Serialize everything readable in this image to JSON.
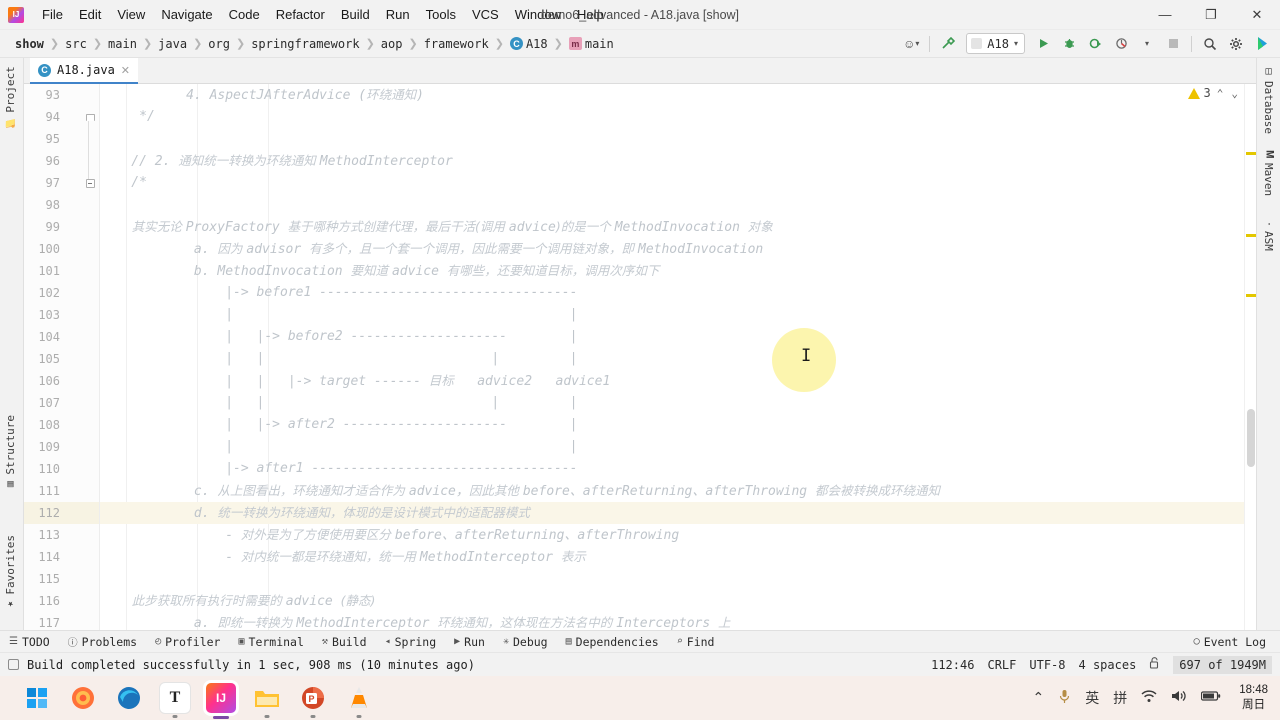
{
  "titlebar": {
    "logo_icon": "intellij-logo-icon",
    "window_title": "demo6_advanced - A18.java [show]",
    "menus": [
      "File",
      "Edit",
      "View",
      "Navigate",
      "Code",
      "Refactor",
      "Build",
      "Run",
      "Tools",
      "VCS",
      "Window",
      "Help"
    ],
    "minimize_icon": "—",
    "maximize_icon": "❐",
    "close_icon": "✕"
  },
  "navbar": {
    "breadcrumbs": [
      "show",
      "src",
      "main",
      "java",
      "org",
      "springframework",
      "aop",
      "framework"
    ],
    "class_crumb": "A18",
    "class_crumb_icon": "C",
    "method_crumb": "main",
    "method_crumb_icon": "m",
    "separator": "❯",
    "toolbar": {
      "profile_icon": "☺",
      "caret_icon": "▾",
      "build_icon": "⚒",
      "run_config": "A18",
      "run_icon": "▶",
      "debug_icon": "⚙",
      "coverage_icon": "◑",
      "profiler_icon": "◴",
      "stop_icon": "■",
      "search_icon": "⌕",
      "settings_icon": "⚙",
      "updates_icon": "◗"
    }
  },
  "left_stripe": {
    "items": [
      {
        "label": "Project",
        "icon": "folder-icon"
      },
      {
        "label": "Structure",
        "icon": "structure-icon"
      },
      {
        "label": "Favorites",
        "icon": "star-icon"
      }
    ]
  },
  "right_stripe": {
    "items": [
      {
        "label": "Database",
        "icon": "database-icon"
      },
      {
        "label": "Maven",
        "icon": "maven-icon"
      },
      {
        "label": "ASM",
        "icon": "asm-icon"
      }
    ]
  },
  "editor_tabs": [
    {
      "label": "A18.java",
      "icon": "java-class-icon",
      "close_icon": "✕",
      "active": true
    }
  ],
  "inspection_widget": {
    "warning_icon": "warning-triangle-icon",
    "warning_count": "3",
    "up_icon": "⌃",
    "down_icon": "⌄"
  },
  "editor": {
    "first_line": 93,
    "highlighted_line": 112,
    "cursor_glyph": "I",
    "lines": [
      {
        "n": 93,
        "indent": 0,
        "segments": [
          {
            "t": "code",
            "v": "           4. AspectJAfterAdvice ("
          },
          {
            "t": "cjk",
            "v": "环绕通知"
          },
          {
            "t": "code",
            "v": ")"
          }
        ]
      },
      {
        "n": 94,
        "indent": 0,
        "fold": "up",
        "segments": [
          {
            "t": "code",
            "v": "     */"
          }
        ]
      },
      {
        "n": 95,
        "indent": 0,
        "segments": []
      },
      {
        "n": 96,
        "indent": 0,
        "segments": [
          {
            "t": "code",
            "v": "    // 2. "
          },
          {
            "t": "cjk",
            "v": "通知统一转换为环绕通知 "
          },
          {
            "t": "code",
            "v": "MethodInterceptor"
          }
        ]
      },
      {
        "n": 97,
        "indent": 0,
        "fold": "down",
        "segments": [
          {
            "t": "code",
            "v": "    /*"
          }
        ]
      },
      {
        "n": 98,
        "indent": 0,
        "segments": []
      },
      {
        "n": 99,
        "indent": 0,
        "segments": [
          {
            "t": "cjk",
            "v": "        其实无论 "
          },
          {
            "t": "code",
            "v": "ProxyFactory "
          },
          {
            "t": "cjk",
            "v": "基于哪种方式创建代理，最后干活(调用 "
          },
          {
            "t": "code",
            "v": "advice"
          },
          {
            "t": "cjk",
            "v": ")的是一个 "
          },
          {
            "t": "code",
            "v": "MethodInvocation "
          },
          {
            "t": "cjk",
            "v": "对象"
          }
        ]
      },
      {
        "n": 100,
        "indent": 0,
        "segments": [
          {
            "t": "code",
            "v": "            a. "
          },
          {
            "t": "cjk",
            "v": "因为 "
          },
          {
            "t": "code",
            "v": "advisor "
          },
          {
            "t": "cjk",
            "v": "有多个，且一个套一个调用，因此需要一个调用链对象，即 "
          },
          {
            "t": "code",
            "v": "MethodInvocation"
          }
        ]
      },
      {
        "n": 101,
        "indent": 0,
        "segments": [
          {
            "t": "code",
            "v": "            b. MethodInvocation "
          },
          {
            "t": "cjk",
            "v": "要知道 "
          },
          {
            "t": "code",
            "v": "advice "
          },
          {
            "t": "cjk",
            "v": "有哪些，还要知道目标，调用次序如下"
          }
        ]
      },
      {
        "n": 102,
        "indent": 0,
        "segments": [
          {
            "t": "code",
            "v": "                |-> before1 ---------------------------------"
          }
        ]
      },
      {
        "n": 103,
        "indent": 0,
        "segments": [
          {
            "t": "code",
            "v": "                |                                           |"
          }
        ]
      },
      {
        "n": 104,
        "indent": 0,
        "segments": [
          {
            "t": "code",
            "v": "                |   |-> before2 --------------------        |"
          }
        ]
      },
      {
        "n": 105,
        "indent": 0,
        "segments": [
          {
            "t": "code",
            "v": "                |   |                             |         |"
          }
        ]
      },
      {
        "n": 106,
        "indent": 0,
        "segments": [
          {
            "t": "code",
            "v": "                |   |   |-> target ------ "
          },
          {
            "t": "cjk",
            "v": "目标"
          },
          {
            "t": "code",
            "v": "   advice2   advice1"
          }
        ]
      },
      {
        "n": 107,
        "indent": 0,
        "segments": [
          {
            "t": "code",
            "v": "                |   |                             |         |"
          }
        ]
      },
      {
        "n": 108,
        "indent": 0,
        "segments": [
          {
            "t": "code",
            "v": "                |   |-> after2 ---------------------        |"
          }
        ]
      },
      {
        "n": 109,
        "indent": 0,
        "segments": [
          {
            "t": "code",
            "v": "                |                                           |"
          }
        ]
      },
      {
        "n": 110,
        "indent": 0,
        "segments": [
          {
            "t": "code",
            "v": "                |-> after1 ----------------------------------"
          }
        ]
      },
      {
        "n": 111,
        "indent": 0,
        "segments": [
          {
            "t": "code",
            "v": "            c. "
          },
          {
            "t": "cjk",
            "v": "从上图看出，环绕通知才适合作为 "
          },
          {
            "t": "code",
            "v": "advice，"
          },
          {
            "t": "cjk",
            "v": "因此其他 "
          },
          {
            "t": "code",
            "v": "before、afterReturning、afterThrowing "
          },
          {
            "t": "cjk",
            "v": "都会被转换成环绕通知"
          }
        ]
      },
      {
        "n": 112,
        "indent": 0,
        "highlight": true,
        "segments": [
          {
            "t": "code",
            "v": "            d. "
          },
          {
            "t": "cjk",
            "v": "统一转换为环绕通知，体现的是设计模式中的适配器模式"
          }
        ]
      },
      {
        "n": 113,
        "indent": 0,
        "segments": [
          {
            "t": "code",
            "v": "                - "
          },
          {
            "t": "cjk",
            "v": "对外是为了方便使用要区分 "
          },
          {
            "t": "code",
            "v": "before、afterReturning、afterThrowing"
          }
        ]
      },
      {
        "n": 114,
        "indent": 0,
        "segments": [
          {
            "t": "code",
            "v": "                - "
          },
          {
            "t": "cjk",
            "v": "对内统一都是环绕通知，统一用 "
          },
          {
            "t": "code",
            "v": "MethodInterceptor "
          },
          {
            "t": "cjk",
            "v": "表示"
          }
        ]
      },
      {
        "n": 115,
        "indent": 0,
        "segments": []
      },
      {
        "n": 116,
        "indent": 0,
        "segments": [
          {
            "t": "cjk",
            "v": "        此步获取所有执行时需要的 "
          },
          {
            "t": "code",
            "v": "advice "
          },
          {
            "t": "cjk",
            "v": "(静态)"
          }
        ]
      },
      {
        "n": 117,
        "indent": 0,
        "segments": [
          {
            "t": "code",
            "v": "            a. "
          },
          {
            "t": "cjk",
            "v": "即统一转换为 "
          },
          {
            "t": "code",
            "v": "MethodInterceptor "
          },
          {
            "t": "cjk",
            "v": "环绕通知，这体现在方法名中的 "
          },
          {
            "t": "code",
            "v": "Interceptors "
          },
          {
            "t": "cjk",
            "v": "上"
          }
        ]
      }
    ]
  },
  "tool_windows": [
    {
      "label": "TODO",
      "icon": "☰"
    },
    {
      "label": "Problems",
      "icon": "ⓘ"
    },
    {
      "label": "Profiler",
      "icon": "◴"
    },
    {
      "label": "Terminal",
      "icon": "▣"
    },
    {
      "label": "Build",
      "icon": "⚒"
    },
    {
      "label": "Spring",
      "icon": "◂"
    },
    {
      "label": "Run",
      "icon": "▶"
    },
    {
      "label": "Debug",
      "icon": "✳"
    },
    {
      "label": "Dependencies",
      "icon": "▤"
    },
    {
      "label": "Find",
      "icon": "⌕"
    }
  ],
  "event_log": {
    "label": "Event Log",
    "icon": "◯"
  },
  "statusbar": {
    "message": "Build completed successfully in 1 sec, 908 ms (10 minutes ago)",
    "message_icon": "build-status-icon",
    "caret_position": "112:46",
    "line_separator": "CRLF",
    "encoding": "UTF-8",
    "indent": "4 spaces",
    "lock_icon": "⚿",
    "memory": "697 of 1949M"
  },
  "markers": {
    "warning_color": "#e3c700",
    "positions": [
      155,
      235,
      295
    ]
  },
  "taskbar": {
    "apps": [
      {
        "name": "start-button",
        "icon": "⊞",
        "color": "#0078d4",
        "state": ""
      },
      {
        "name": "firefox",
        "icon": "◔",
        "color": "#ff7139",
        "state": ""
      },
      {
        "name": "edge",
        "icon": "◉",
        "color": "#0e7ec1",
        "state": ""
      },
      {
        "name": "typora",
        "icon": "T",
        "color": "#ffffff",
        "state": "run"
      },
      {
        "name": "intellij-idea",
        "icon": "IJ",
        "color": "#ff318c",
        "state": "active"
      },
      {
        "name": "file-explorer",
        "icon": "▮",
        "color": "#ffc233",
        "state": "run"
      },
      {
        "name": "powerpoint",
        "icon": "P",
        "color": "#d24726",
        "state": "run"
      },
      {
        "name": "vlc",
        "icon": "▲",
        "color": "#ff8800",
        "state": "run"
      }
    ],
    "tray": [
      "⌃",
      "Ʈ",
      "英",
      "拼",
      "◑",
      "⦿",
      "▭"
    ],
    "clock_time": "18:48",
    "clock_day": "周日"
  }
}
